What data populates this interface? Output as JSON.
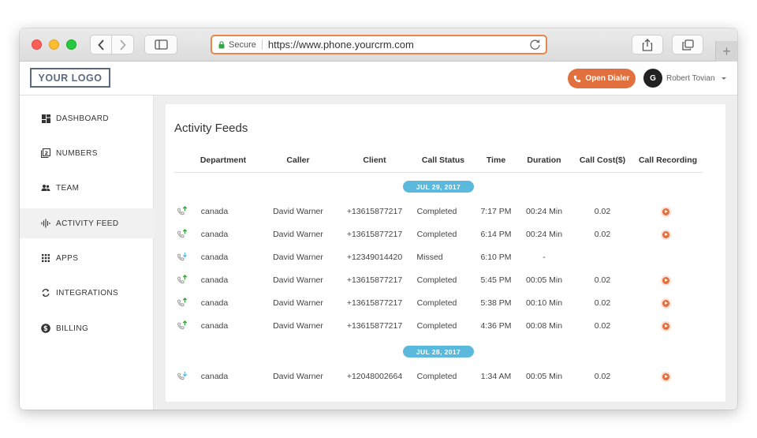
{
  "browser": {
    "secure_label": "Secure",
    "url": "https://www.phone.yourcrm.com"
  },
  "header": {
    "logo": "YOUR LOGO",
    "open_dialer_label": "Open Dialer",
    "user_initial": "G",
    "user_name": "Robert Tovian"
  },
  "colors": {
    "accent": "#e2703f",
    "date_pill": "#5bb9dd",
    "incoming_icon": "#5bb9dd",
    "outgoing_icon": "#3a9b3a"
  },
  "sidebar": {
    "items": [
      {
        "label": "DASHBOARD",
        "icon": "dashboard-icon"
      },
      {
        "label": "NUMBERS",
        "icon": "numbers-icon"
      },
      {
        "label": "TEAM",
        "icon": "team-icon"
      },
      {
        "label": "ACTIVITY FEED",
        "icon": "waveform-icon",
        "active": true
      },
      {
        "label": "APPS",
        "icon": "grid-icon"
      },
      {
        "label": "INTEGRATIONS",
        "icon": "sync-icon"
      },
      {
        "label": "BILLING",
        "icon": "dollar-icon"
      }
    ]
  },
  "feed": {
    "title": "Activity Feeds",
    "columns": [
      "Department",
      "Caller",
      "Client",
      "Call Status",
      "Time",
      "Duration",
      "Call Cost($)",
      "Call Recording"
    ],
    "groups": [
      {
        "date": "JUL 29, 2017",
        "rows": [
          {
            "direction": "outgoing",
            "department": "canada",
            "caller": "David Warner",
            "client": "+13615877217",
            "status": "Completed",
            "time": "7:17 PM",
            "duration": "00:24 Min",
            "cost": "0.02",
            "recording": true
          },
          {
            "direction": "outgoing",
            "department": "canada",
            "caller": "David Warner",
            "client": "+13615877217",
            "status": "Completed",
            "time": "6:14 PM",
            "duration": "00:24 Min",
            "cost": "0.02",
            "recording": true
          },
          {
            "direction": "incoming",
            "department": "canada",
            "caller": "David Warner",
            "client": "+12349014420",
            "status": "Missed",
            "time": "6:10 PM",
            "duration": "-",
            "cost": "",
            "recording": false
          },
          {
            "direction": "outgoing",
            "department": "canada",
            "caller": "David Warner",
            "client": "+13615877217",
            "status": "Completed",
            "time": "5:45 PM",
            "duration": "00:05 Min",
            "cost": "0.02",
            "recording": true
          },
          {
            "direction": "outgoing",
            "department": "canada",
            "caller": "David Warner",
            "client": "+13615877217",
            "status": "Completed",
            "time": "5:38 PM",
            "duration": "00:10 Min",
            "cost": "0.02",
            "recording": true
          },
          {
            "direction": "outgoing",
            "department": "canada",
            "caller": "David Warner",
            "client": "+13615877217",
            "status": "Completed",
            "time": "4:36 PM",
            "duration": "00:08 Min",
            "cost": "0.02",
            "recording": true
          }
        ]
      },
      {
        "date": "JUL 28, 2017",
        "rows": [
          {
            "direction": "incoming",
            "department": "canada",
            "caller": "David Warner",
            "client": "+12048002664",
            "status": "Completed",
            "time": "1:34 AM",
            "duration": "00:05 Min",
            "cost": "0.02",
            "recording": true
          }
        ]
      }
    ]
  }
}
